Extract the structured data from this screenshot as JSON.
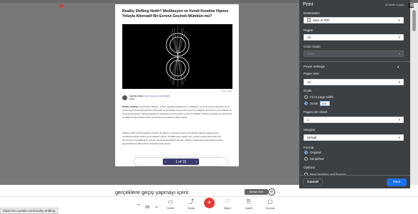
{
  "article": {
    "title": "Reality Shifting Nedir? Meditasyon ve Kendi Kendine Hipnoz Yoluyla Alternatif Bir Evrene Geçmek Mümkün mü?",
    "bottom_text": "gerçeklere geçiş yapmayı içerir.",
    "author_name": "Fadıl Bertüzkin",
    "author_link": "https://onedio.com/profil/fadil",
    "author_role": "Editör",
    "image_caption": "7 Mayıs 2023",
    "body_p1_bold": "Reality shifting",
    "body_p1": " (veya kısaca 'shifting'. Türkçe 'gerçeklik değiştirme'), meditasyon ve kendi kendini hipnotize etme yöntemlerini kullanarak bilincinizi alternatif bir gerçekliğe veya evrene geçirme pratiğidir. Bu kavram, Sinemalarda ve romanlarda görülen hayali karakterlerin yaşadığı evrenlere gitme arzusu ile ilişkilidir. Shifting yapanlar, bu evrenlerde kendilerini hayal ettikleri kişiler olarak deneyimlediklerini iddia ederler.",
    "body_p2": "Shifting, 2020 yılında başlayan COVID-19 salgını ve karantina dönemi ile birlikte TikTok uygulamasının popülerleşmesiyle birlikte geniş kitlelere yayıldı. Özellikle genç kullanıcılar, sosyal medya platformlarında deneyimlerini paylaşarak bu trendin yayılmasına katkıda bulundu. Shifting, kullanıcıların alternatif evrenlere geçebildiklerini iddia ettikleri videolarla hızla yayıldı."
  },
  "pager": {
    "label": "1 of 15",
    "prev": "‹",
    "next": "›"
  },
  "print_panel": {
    "title": "Print",
    "sheets": "15 sheets of paper",
    "destination_label": "Destination",
    "destination_value": "Save to PDF",
    "pages_label": "Pages",
    "pages_value": "All",
    "color_label": "Color mode",
    "color_value": "Color",
    "fewer_settings": "Fewer settings",
    "paper_size_label": "Paper size",
    "paper_size_value": "A4",
    "scale_label": "Scale",
    "fit_label": "Fit to page width",
    "scale_option": "Scale",
    "scale_value": "100",
    "pages_per_sheet_label": "Pages per sheet",
    "pages_per_sheet_value": "1",
    "margins_label": "Margins",
    "margins_value": "Default",
    "format_label": "Format",
    "format_original": "Original",
    "format_simplified": "Simplified",
    "options_label": "Options",
    "headers_footers": "Print headers and footers",
    "cancel": "Cancel",
    "save": "Save"
  },
  "bottom_bar": {
    "url": "https://en.onedio.com/reality-shifting",
    "count": "28",
    "items": [
      "Sözlük",
      "Paylaş",
      "Beğen",
      "Kaydet",
      "Yorumlar"
    ],
    "tooltip": "Menüyü Gizle"
  },
  "colors": {
    "panel_bg": "#3c4043",
    "accent": "#1a73e8",
    "plus": "#e53935"
  }
}
